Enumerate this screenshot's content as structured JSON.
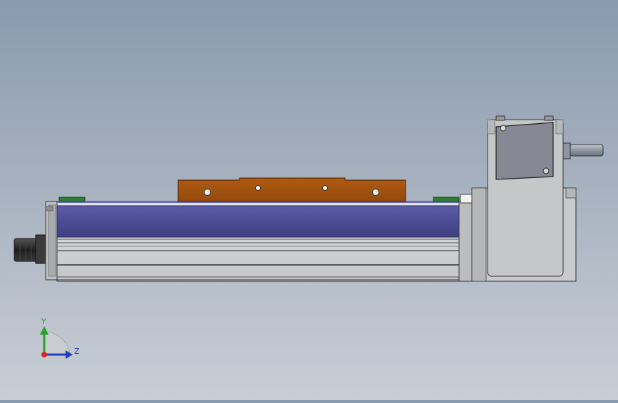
{
  "viewport": {
    "background_top": "#8a9aaf",
    "background_bottom": "#c9ced6"
  },
  "model": {
    "parts": [
      {
        "name": "linear-actuator-body",
        "color": "#d2d3d4"
      },
      {
        "name": "carriage-cover-strip",
        "color": "#4a4a8e"
      },
      {
        "name": "slide-carriage-plate",
        "color": "#a4530f"
      },
      {
        "name": "end-stop-pads",
        "color": "#2e7d32"
      },
      {
        "name": "cable-connector",
        "color": "#2b2b2b"
      },
      {
        "name": "motor-housing",
        "color": "#c9cacb"
      },
      {
        "name": "terminal-box",
        "color": "#878893"
      },
      {
        "name": "motor-shaft",
        "color": "#8f96a2"
      }
    ]
  },
  "triad": {
    "y_label": "Y",
    "z_label": "Z",
    "y_color": "#2ca02c",
    "z_color": "#1f3fbf",
    "origin_color": "#d42a2a"
  }
}
